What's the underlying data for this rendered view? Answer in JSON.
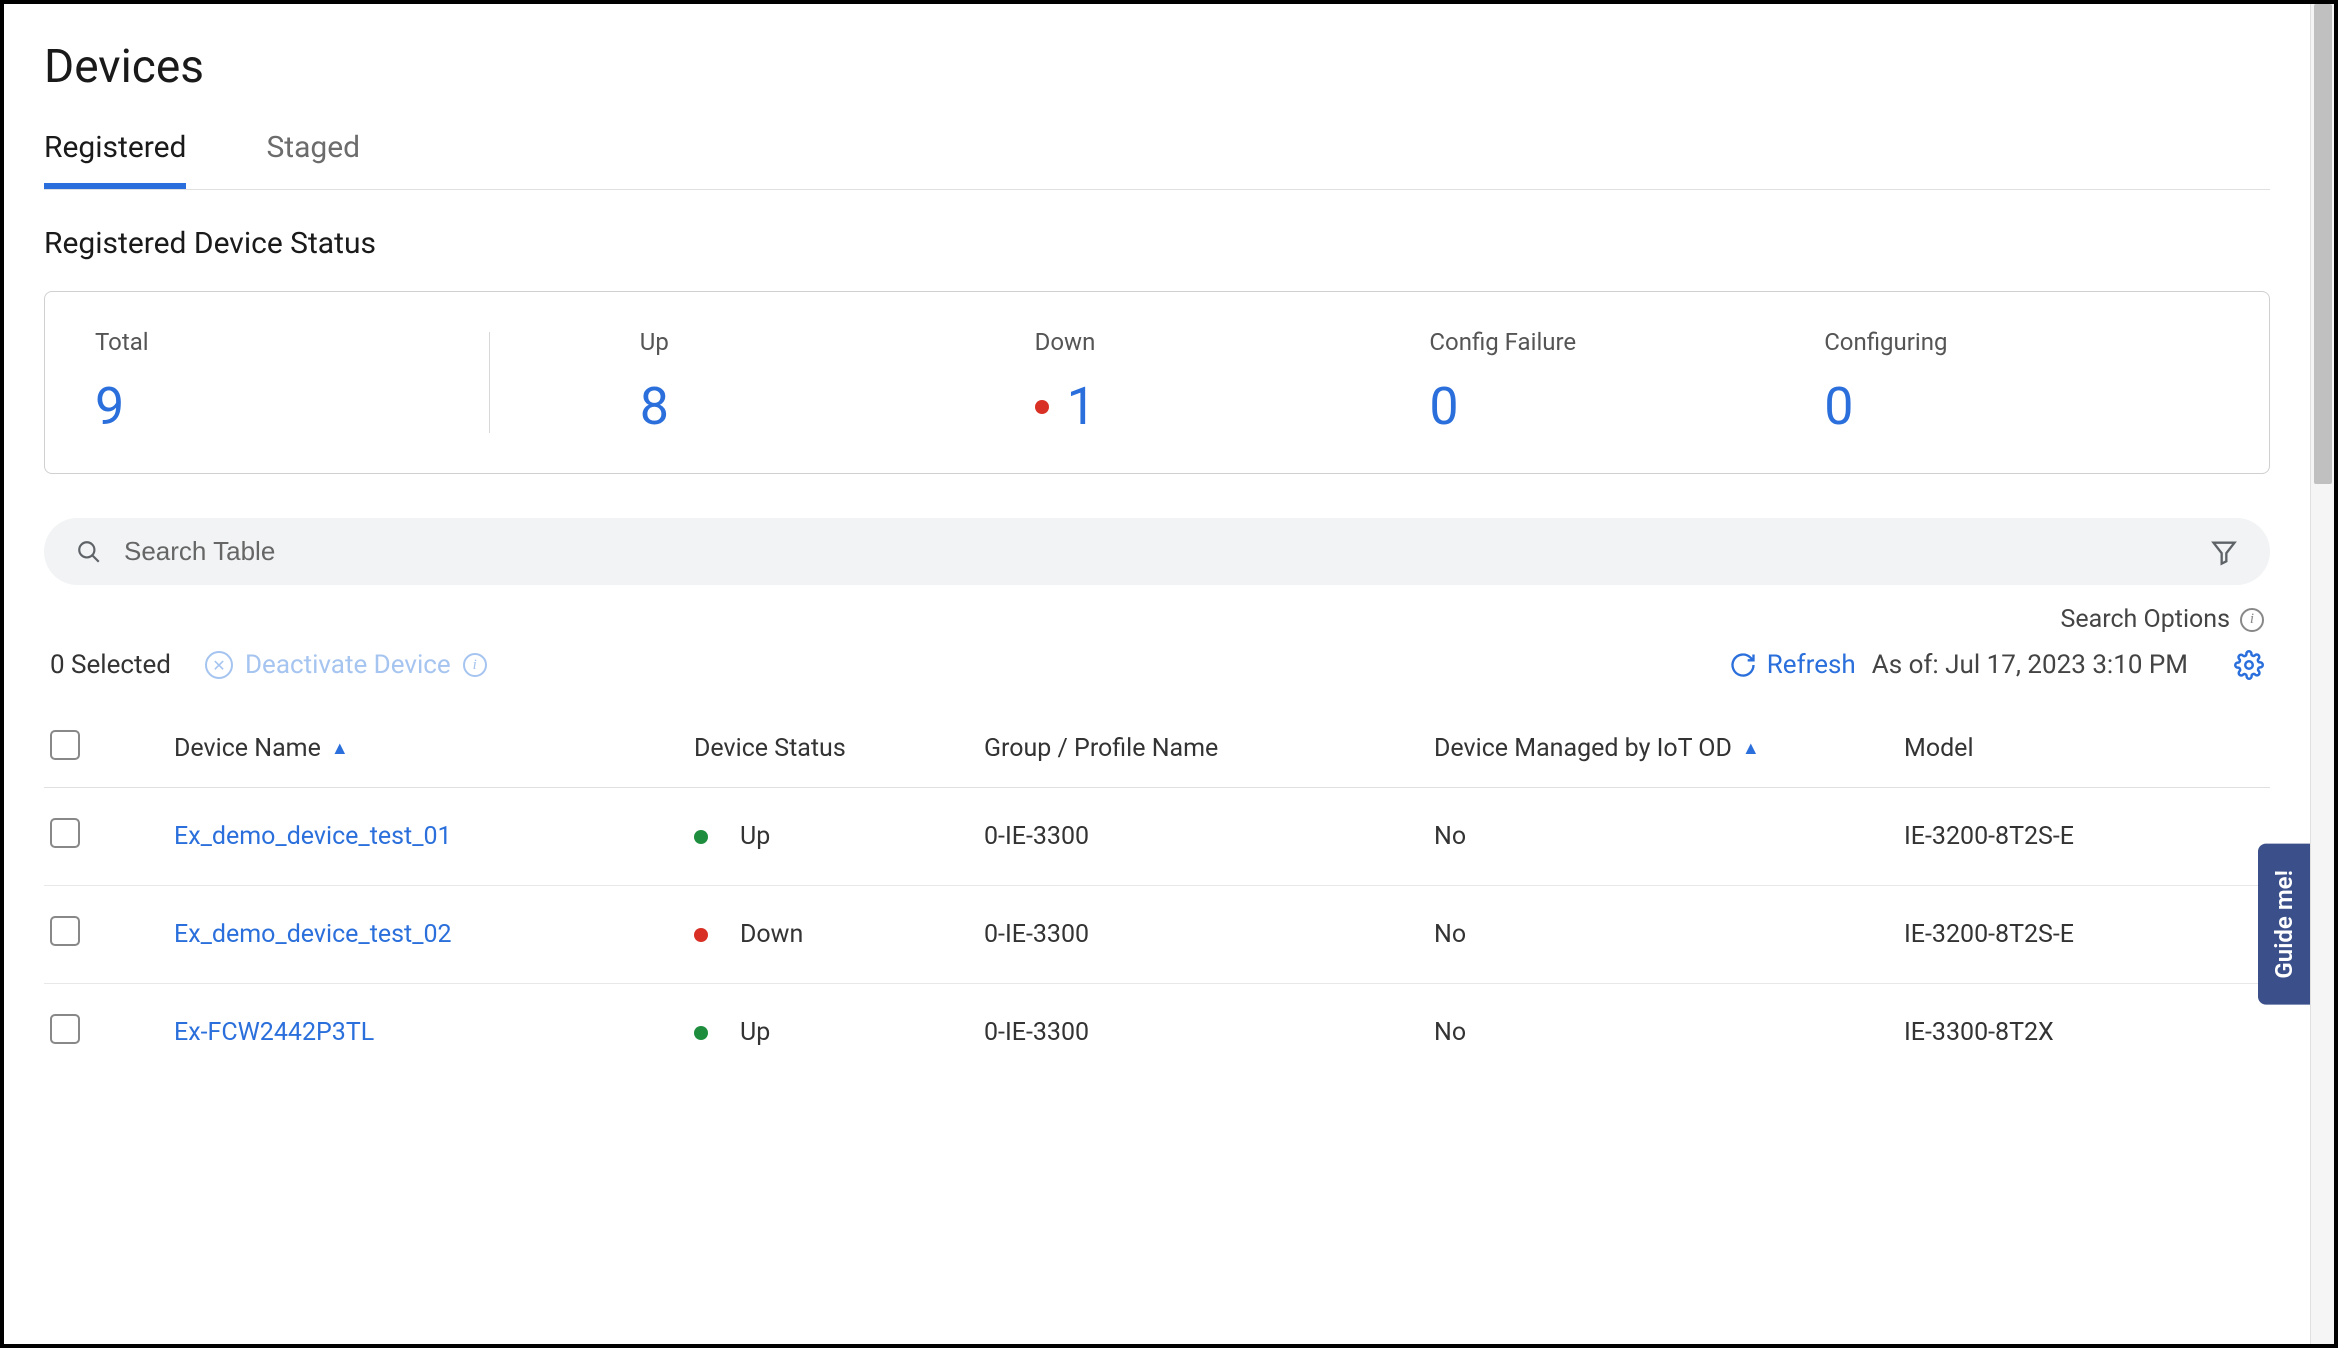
{
  "page_title": "Devices",
  "tabs": {
    "registered": "Registered",
    "staged": "Staged"
  },
  "section_title": "Registered Device Status",
  "status": {
    "total": {
      "label": "Total",
      "value": "9"
    },
    "up": {
      "label": "Up",
      "value": "8"
    },
    "down": {
      "label": "Down",
      "value": "1"
    },
    "config_failure": {
      "label": "Config Failure",
      "value": "0"
    },
    "configuring": {
      "label": "Configuring",
      "value": "0"
    }
  },
  "search": {
    "placeholder": "Search Table",
    "options_label": "Search Options"
  },
  "toolbar": {
    "selected": "0 Selected",
    "deactivate": "Deactivate Device",
    "refresh": "Refresh",
    "asof": "As of: Jul 17, 2023 3:10 PM"
  },
  "table": {
    "headers": {
      "name": "Device Name",
      "status": "Device Status",
      "group": "Group / Profile Name",
      "managed": "Device Managed by IoT OD",
      "model": "Model"
    },
    "rows": [
      {
        "name": "Ex_demo_device_test_01",
        "status": "Up",
        "status_color": "green",
        "group": "0-IE-3300",
        "managed": "No",
        "model": "IE-3200-8T2S-E"
      },
      {
        "name": "Ex_demo_device_test_02",
        "status": "Down",
        "status_color": "red",
        "group": "0-IE-3300",
        "managed": "No",
        "model": "IE-3200-8T2S-E"
      },
      {
        "name": "Ex-FCW2442P3TL",
        "status": "Up",
        "status_color": "green",
        "group": "0-IE-3300",
        "managed": "No",
        "model": "IE-3300-8T2X"
      }
    ]
  },
  "guide_me": "Guide me!"
}
